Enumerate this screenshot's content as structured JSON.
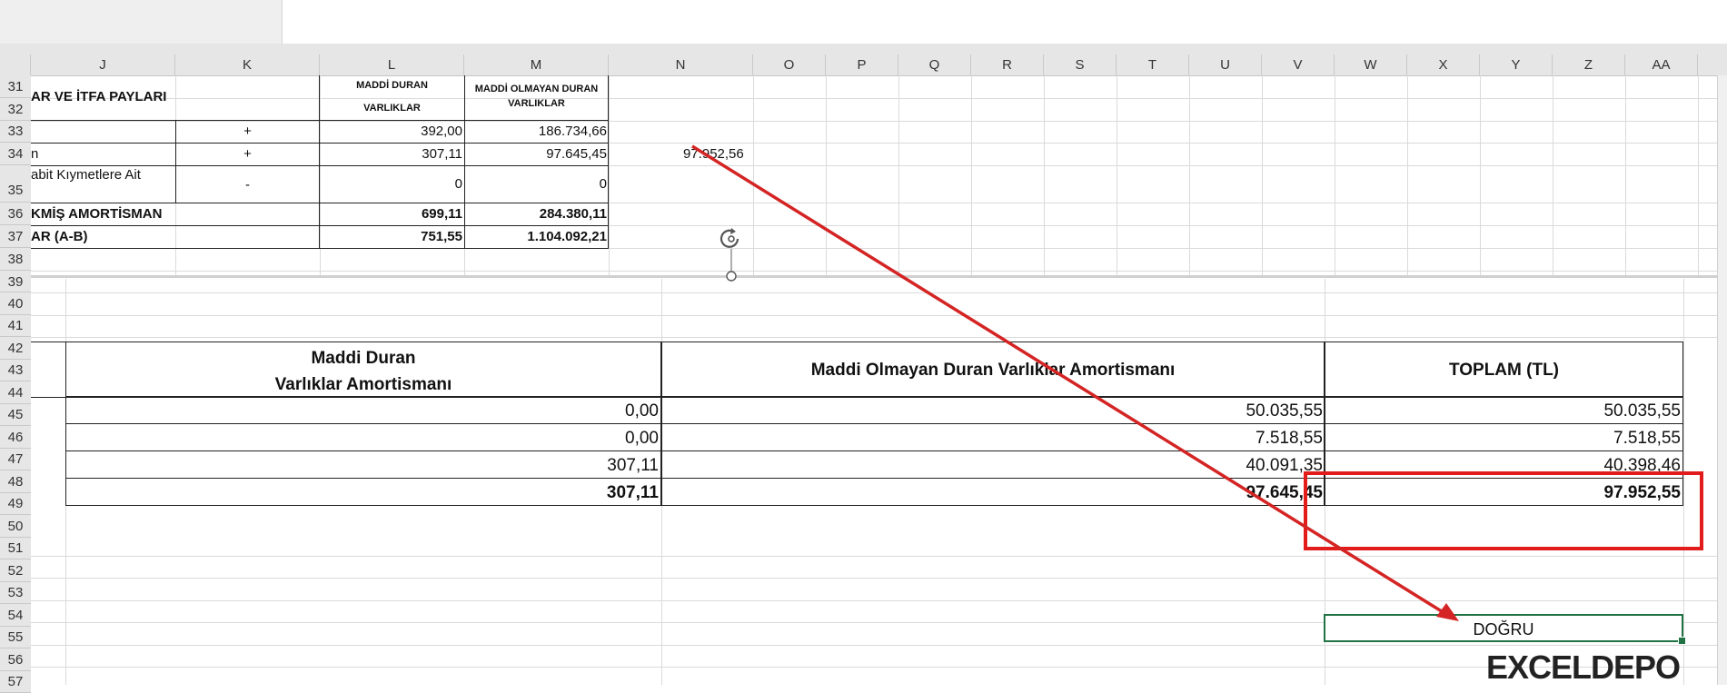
{
  "columns": [
    "J",
    "K",
    "L",
    "M",
    "N",
    "O",
    "P",
    "Q",
    "R",
    "S",
    "T",
    "U",
    "V",
    "W",
    "X",
    "Y",
    "Z",
    "AA"
  ],
  "rows": [
    "31",
    "32",
    "33",
    "34",
    "35",
    "36",
    "37",
    "38",
    "39",
    "40",
    "41",
    "42",
    "43",
    "44",
    "45",
    "46",
    "47",
    "48",
    "49",
    "50",
    "51",
    "52",
    "53",
    "54",
    "55",
    "56",
    "57"
  ],
  "upper_table": {
    "title": "AR VE İTFA PAYLARI",
    "header_l_line1": "MADDİ DURAN",
    "header_l_line2": "VARLIKLAR",
    "header_m_line1": "MADDİ OLMAYAN DURAN",
    "header_m_line2": "VARLIKLAR",
    "row33": {
      "j": "",
      "k": "+",
      "l": "392,00",
      "m": "186.734,66"
    },
    "row34": {
      "j": "n",
      "k": "+",
      "l": "307,11",
      "m": "97.645,45"
    },
    "row35": {
      "j": "abit   Kıymetlere   Ait",
      "k": "-",
      "l": "0",
      "m": "0"
    },
    "row36": {
      "j": "KMİŞ AMORTİSMAN",
      "l": "699,11",
      "m": "284.380,11"
    },
    "row37": {
      "j": "AR (A-B)",
      "l": "751,55",
      "m": "1.104.092,21"
    }
  },
  "n34_value": "97.952,56",
  "lower_table": {
    "col1_header_line1": "Maddi Duran",
    "col1_header_line2": "Varlıklar Amortismanı",
    "col2_header": "Maddi Olmayan Duran Varlıklar Amortismanı",
    "col3_header": "TOPLAM (TL)",
    "rows": [
      {
        "c1": "0,00",
        "c2": "50.035,55",
        "c3": "50.035,55"
      },
      {
        "c1": "0,00",
        "c2": "7.518,55",
        "c3": "7.518,55"
      },
      {
        "c1": "307,11",
        "c2": "40.091,35",
        "c3": "40.398,46"
      }
    ],
    "total": {
      "c1": "307,11",
      "c2": "97.645,45",
      "c3": "97.952,55"
    }
  },
  "result_cell": "DOĞRU",
  "logo_text": "EXCELDEPO",
  "colors": {
    "arrow": "#d42424",
    "highlight": "#e21b1b",
    "selection": "#217346",
    "logo_green": "#3bb54a"
  }
}
